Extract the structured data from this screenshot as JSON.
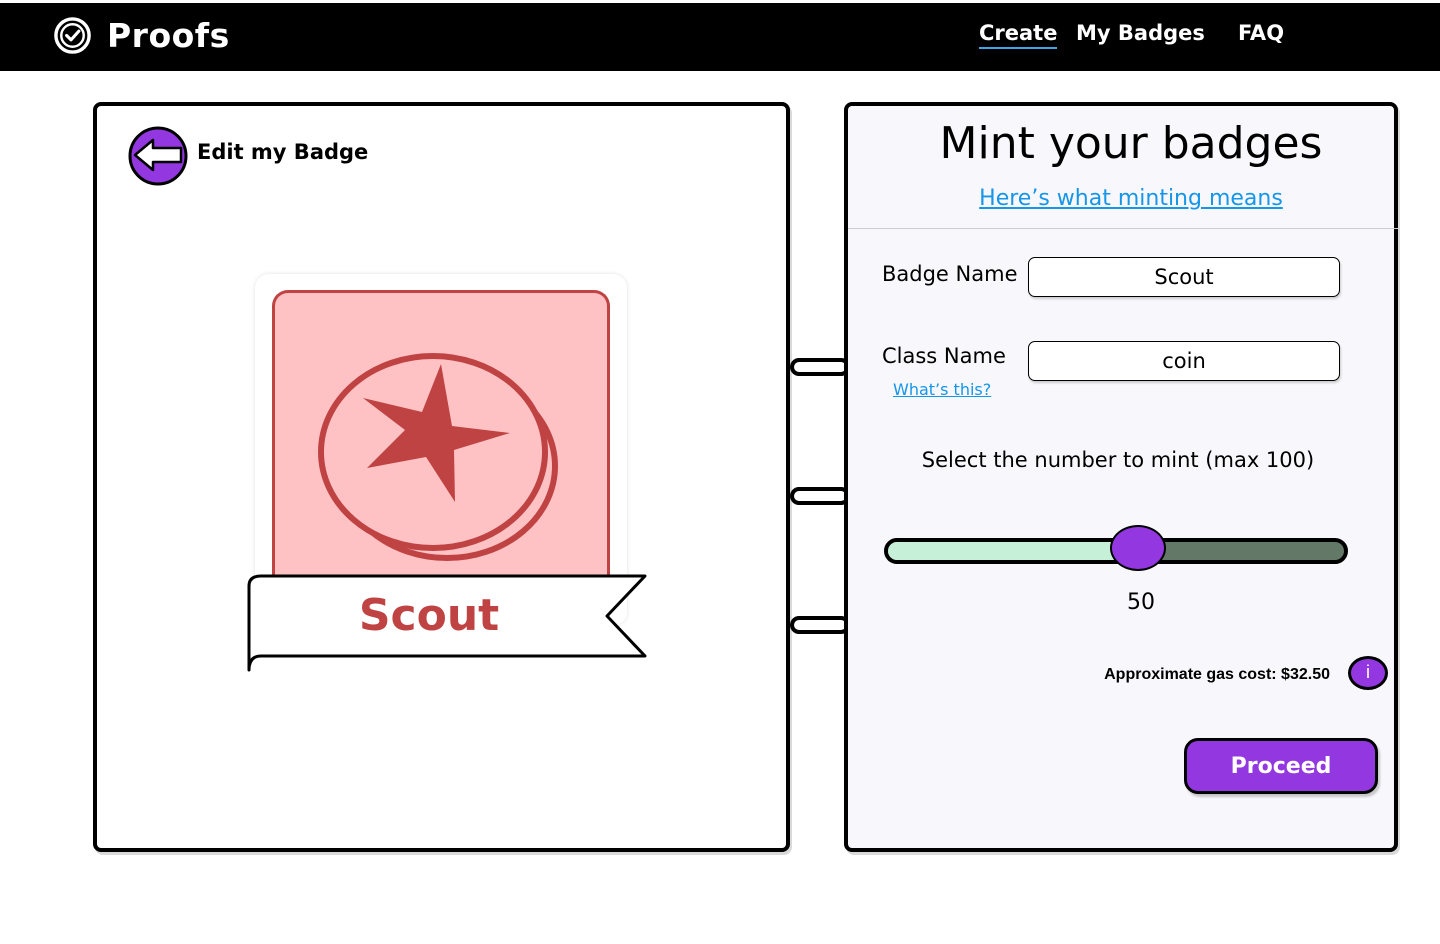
{
  "app": {
    "name": "Proofs"
  },
  "nav": {
    "create": "Create",
    "my_badges": "My Badges",
    "faq": "FAQ"
  },
  "editor": {
    "title": "Edit my Badge",
    "badge": {
      "name": "Scout",
      "icon": "coin-star-icon",
      "card_color": "#ffc2c4",
      "accent_color": "#c04343"
    }
  },
  "mint": {
    "title": "Mint your badges",
    "help_link": "Here’s what minting means",
    "badge_name_label": "Badge Name",
    "badge_name_value": "Scout",
    "class_name_label": "Class Name",
    "class_name_value": "coin",
    "whats_this": "What’s this?",
    "select_label": "Select the number to mint (max 100)",
    "slider": {
      "value": 50,
      "max": 100,
      "value_text": "50"
    },
    "gas_cost": "Approximate gas cost: $32.50",
    "info_label": "i",
    "proceed": "Proceed"
  },
  "colors": {
    "accent_purple": "#9337e0",
    "link_blue": "#1596e8",
    "slider_fill": "#c6f1d8",
    "slider_track": "#637866"
  }
}
